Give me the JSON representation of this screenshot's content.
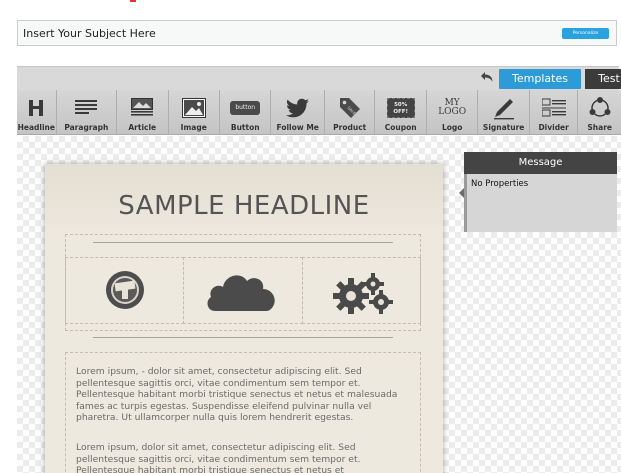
{
  "subject": {
    "value": "Insert Your Subject Here",
    "personalize_label": "Personalize"
  },
  "toolbar": {
    "templates_label": "Templates",
    "test_label": "Test"
  },
  "tools": [
    {
      "label": "Headline",
      "icon": "headline-icon"
    },
    {
      "label": "Paragraph",
      "icon": "paragraph-icon"
    },
    {
      "label": "Article",
      "icon": "article-icon"
    },
    {
      "label": "Image",
      "icon": "image-icon"
    },
    {
      "label": "Button",
      "icon": "button-icon",
      "icon_text": "button"
    },
    {
      "label": "Follow Me",
      "icon": "twitter-bird-icon"
    },
    {
      "label": "Product",
      "icon": "price-tag-icon"
    },
    {
      "label": "Coupon",
      "icon": "coupon-icon",
      "icon_text": "50% OFF!"
    },
    {
      "label": "Logo",
      "icon": "logo-icon",
      "icon_text": "MY LOGO"
    },
    {
      "label": "Signature",
      "icon": "pen-icon"
    },
    {
      "label": "Divider",
      "icon": "divider-icon"
    },
    {
      "label": "Share",
      "icon": "share-icon"
    }
  ],
  "email": {
    "headline": "SAMPLE HEADLINE",
    "icons": [
      "badge-icon",
      "cloud-icon",
      "gears-icon"
    ],
    "paragraph1": "Lorem ipsum, - dolor sit amet, consectetur adipiscing elit. Sed pellentesque sagittis orci, vitae condimentum sem tempor et. Pellentesque habitant morbi tristique senectus et netus et malesuada fames ac turpis egestas. Suspendisse eleifend pulvinar nulla vel pharetra. Ut ullamcorper nulla quis lorem hendrerit egestas.",
    "paragraph2": "Lorem ipsum, dolor sit amet, consectetur adipiscing elit. Sed pellentesque sagittis orci, vitae condimentum sem tempor et. Pellentesque habitant morbi tristique senectus et netus et"
  },
  "message_panel": {
    "title": "Message",
    "body": "No Properties"
  },
  "colors": {
    "accent_blue": "#2c9bd8",
    "dark": "#3b3b3b",
    "panel_header": "#444444"
  }
}
